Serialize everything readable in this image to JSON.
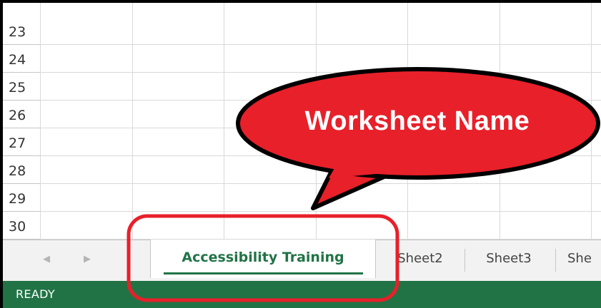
{
  "grid": {
    "rows": [
      "23",
      "24",
      "25",
      "26",
      "27",
      "28",
      "29",
      "30"
    ]
  },
  "tab_bar": {
    "nav_prev": "◀",
    "nav_next": "▶",
    "active_tab": "Accessibility Training",
    "tabs": [
      "Sheet2",
      "Sheet3",
      "She"
    ]
  },
  "status_bar": {
    "status": "READY"
  },
  "annotation": {
    "label": "Worksheet Name",
    "bubble_color": "#e8202a",
    "highlight_color": "#e8202a"
  },
  "colors": {
    "excel_green": "#217346"
  }
}
